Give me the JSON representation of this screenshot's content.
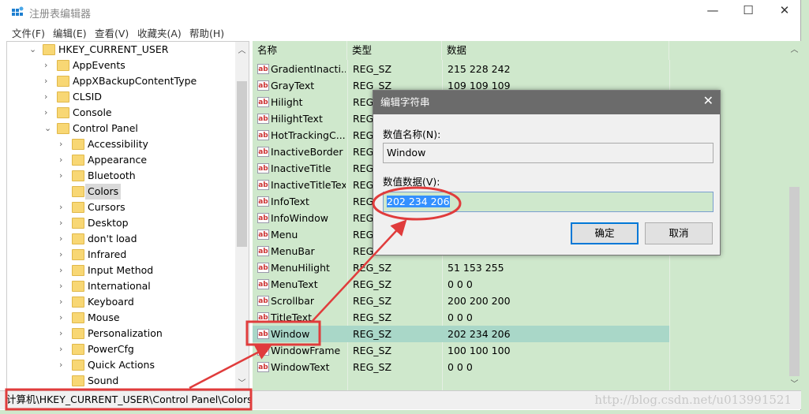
{
  "window": {
    "title": "注册表编辑器",
    "minimize": "—",
    "maximize": "☐",
    "close": "✕"
  },
  "menu": [
    "文件(F)",
    "编辑(E)",
    "查看(V)",
    "收藏夹(A)",
    "帮助(H)"
  ],
  "tree": {
    "root": "HKEY_CURRENT_USER",
    "children": [
      "AppEvents",
      "AppXBackupContentType",
      "CLSID",
      "Console",
      "Control Panel"
    ],
    "control_panel_children": [
      "Accessibility",
      "Appearance",
      "Bluetooth",
      "Colors",
      "Cursors",
      "Desktop",
      "don't load",
      "Infrared",
      "Input Method",
      "International",
      "Keyboard",
      "Mouse",
      "Personalization",
      "PowerCfg",
      "Quick Actions",
      "Sound"
    ],
    "selected": "Colors"
  },
  "list": {
    "headers": [
      "名称",
      "类型",
      "数据"
    ],
    "rows": [
      {
        "name": "GradientInacti...",
        "type": "REG_SZ",
        "data": "215 228 242"
      },
      {
        "name": "GrayText",
        "type": "REG_SZ",
        "data": "109 109 109"
      },
      {
        "name": "Hilight",
        "type": "REG",
        "data": ""
      },
      {
        "name": "HilightText",
        "type": "REG",
        "data": ""
      },
      {
        "name": "HotTrackingC...",
        "type": "REG",
        "data": ""
      },
      {
        "name": "InactiveBorder",
        "type": "REG",
        "data": ""
      },
      {
        "name": "InactiveTitle",
        "type": "REG",
        "data": ""
      },
      {
        "name": "InactiveTitleText",
        "type": "REG",
        "data": ""
      },
      {
        "name": "InfoText",
        "type": "REG",
        "data": ""
      },
      {
        "name": "InfoWindow",
        "type": "REG",
        "data": ""
      },
      {
        "name": "Menu",
        "type": "REG",
        "data": ""
      },
      {
        "name": "MenuBar",
        "type": "REG",
        "data": ""
      },
      {
        "name": "MenuHilight",
        "type": "REG_SZ",
        "data": "51 153 255"
      },
      {
        "name": "MenuText",
        "type": "REG_SZ",
        "data": "0 0 0"
      },
      {
        "name": "Scrollbar",
        "type": "REG_SZ",
        "data": "200 200 200"
      },
      {
        "name": "TitleText",
        "type": "REG_SZ",
        "data": "0 0 0"
      },
      {
        "name": "Window",
        "type": "REG_SZ",
        "data": "202 234 206"
      },
      {
        "name": "WindowFrame",
        "type": "REG_SZ",
        "data": "100 100 100"
      },
      {
        "name": "WindowText",
        "type": "REG_SZ",
        "data": "0 0 0"
      }
    ],
    "selected": "Window",
    "icon": "ab"
  },
  "status": {
    "path": "计算机\\HKEY_CURRENT_USER\\Control Panel\\Colors",
    "watermark": "http://blog.csdn.net/u013991521"
  },
  "dialog": {
    "title": "编辑字符串",
    "name_label": "数值名称(N):",
    "name_value": "Window",
    "data_label": "数值数据(V):",
    "data_value": "202 234 206",
    "ok": "确定",
    "cancel": "取消",
    "close": "✕"
  },
  "colors": {
    "window_bg": "#cfe8cc",
    "annotation": "#e03c3c",
    "selection": "#3390ff"
  }
}
